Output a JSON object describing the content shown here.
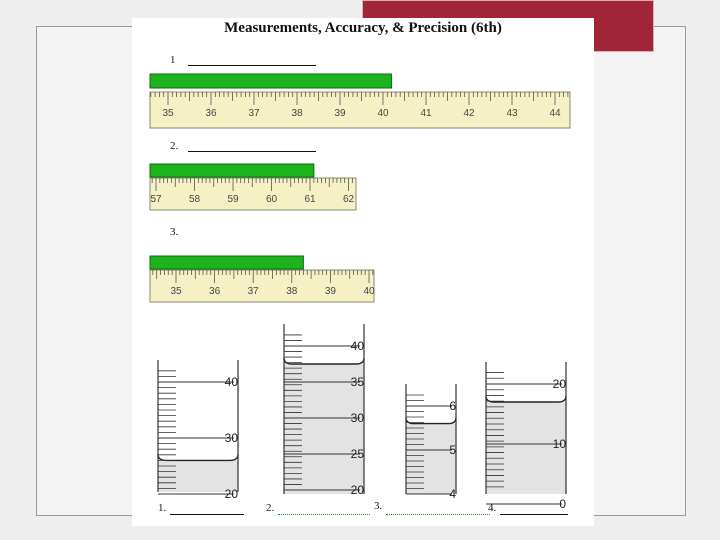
{
  "slide": {
    "accent_color": "#a02536"
  },
  "worksheet": {
    "title": "Measurements, Accuracy, & Precision (6th)",
    "questions": [
      {
        "number": "1",
        "ruler_labels": [
          "35",
          "36",
          "37",
          "38",
          "39",
          "40",
          "41",
          "42",
          "43",
          "44"
        ],
        "bar_end_value": 40.2
      },
      {
        "number": "2.",
        "ruler_labels": [
          "57",
          "58",
          "59",
          "60",
          "61",
          "62"
        ],
        "bar_end_value": 61.1
      },
      {
        "number": "3.",
        "ruler_labels": [
          "35",
          "36",
          "37",
          "38",
          "39",
          "40"
        ],
        "bar_end_value": 38.3
      }
    ],
    "bar_color": "#1db31d",
    "ruler_color": "#f6f1c4",
    "cylinders": [
      {
        "labels": [
          "40",
          "30",
          "20"
        ],
        "level": 26
      },
      {
        "labels": [
          "40",
          "35",
          "30",
          "25",
          "20"
        ],
        "level": 37.5
      },
      {
        "labels": [
          "6",
          "5",
          "4"
        ],
        "level": 5.6
      },
      {
        "labels": [
          "20",
          "10",
          "0"
        ],
        "level": 17
      }
    ],
    "cylinder_answers": [
      "1.",
      "2.",
      "3.",
      "4."
    ]
  }
}
